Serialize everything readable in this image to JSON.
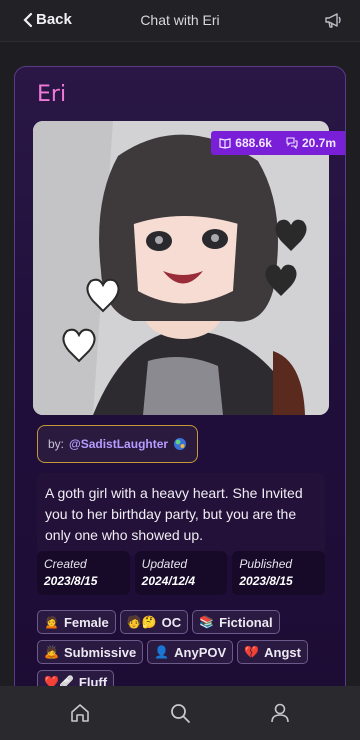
{
  "header": {
    "back_label": "Back",
    "title": "Chat with Eri",
    "announce_icon": "megaphone-icon"
  },
  "character": {
    "name": "Eri",
    "stats": {
      "reads": "688.6k",
      "chats": "20.7m"
    },
    "author_prefix": "by:",
    "author": "@SadistLaughter",
    "description": "A goth girl with a heavy heart. She Invited you to her birthday party, but you are the only one who showed up.",
    "dates": [
      {
        "label": "Created",
        "value": "2023/8/15"
      },
      {
        "label": "Updated",
        "value": "2024/12/4"
      },
      {
        "label": "Published",
        "value": "2023/8/15"
      }
    ],
    "tags": [
      {
        "emoji": "🙍",
        "label": "Female"
      },
      {
        "emoji": "🧑🤔",
        "label": "OC"
      },
      {
        "emoji": "📚",
        "label": "Fictional"
      },
      {
        "emoji": "🙇",
        "label": "Submissive"
      },
      {
        "emoji": "👤",
        "label": "AnyPOV"
      },
      {
        "emoji": "💔",
        "label": "Angst"
      },
      {
        "emoji": "❤️🩹",
        "label": "Fluff"
      }
    ]
  },
  "nav": [
    {
      "name": "home-icon"
    },
    {
      "name": "search-icon"
    },
    {
      "name": "profile-icon"
    }
  ],
  "colors": {
    "accent": "#7a1fd8",
    "name": "#f07ad8",
    "border_gold": "#c7973b"
  }
}
